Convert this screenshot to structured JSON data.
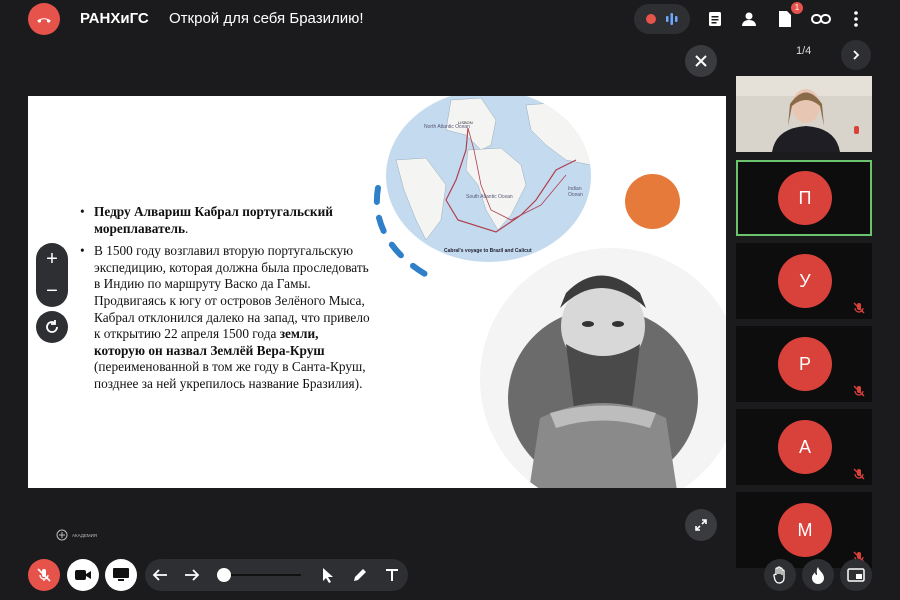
{
  "header": {
    "brand": "РАНХиГС",
    "title": "Открой для себя Бразилию!",
    "notification_count": "1"
  },
  "slide": {
    "bullet1_bold": "Педру Алвариш Кабрал португальский мореплаватель",
    "bullet1_tail": ".",
    "bullet2_p1": "В 1500 году возглавил вторую португальскую экспедицию, которая должна была проследовать в Индию по маршруту Васко да Гамы. Продвигаясь к югу от островов Зелёного Мыса, Кабрал отклонился далеко на запад, что привело к открытию 22 апреля 1500 года ",
    "bullet2_bold": "земли, которую он назвал Землёй Вера-Круш",
    "bullet2_p2": " (переименованной в том же году в Санта-Круш, позднее за ней укрепилось название Бразилия).",
    "map": {
      "caption": "Cabral's voyage to Brazil and Calicut",
      "labels": [
        "North Atlantic Ocean",
        "South Atlantic Ocean",
        "Indian Ocean",
        "LISBON"
      ]
    },
    "logo_text": "АКАДЕМИЯ"
  },
  "pager": {
    "label": "1/4"
  },
  "participants": [
    {
      "initial": "П",
      "active": true,
      "muted": false
    },
    {
      "initial": "У",
      "active": false,
      "muted": true
    },
    {
      "initial": "Р",
      "active": false,
      "muted": true
    },
    {
      "initial": "А",
      "active": false,
      "muted": true
    },
    {
      "initial": "М",
      "active": false,
      "muted": true
    }
  ],
  "zoom": {
    "plus": "+",
    "minus": "−"
  },
  "colors": {
    "accent_red": "#e5534b",
    "active_border": "#6bc36b",
    "orange": "#e67a3b"
  }
}
